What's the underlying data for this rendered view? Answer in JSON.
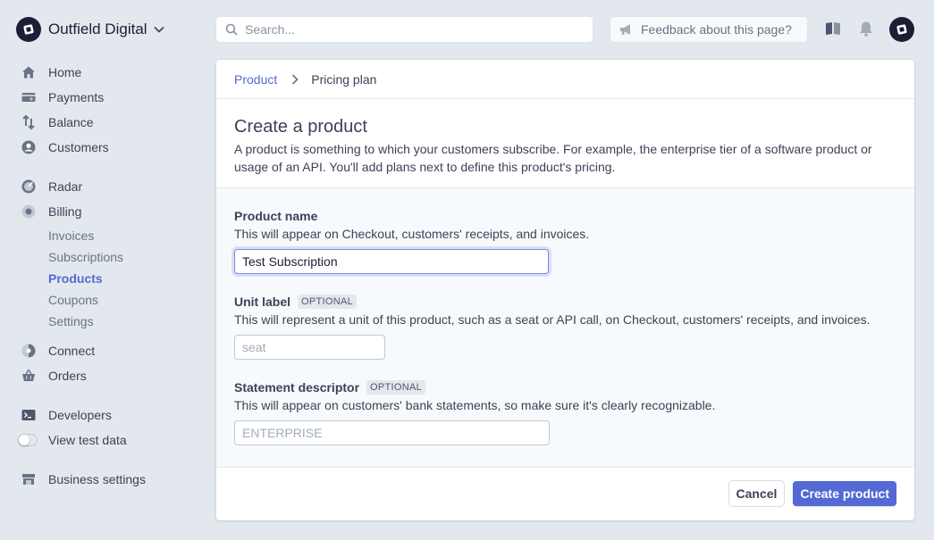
{
  "account": {
    "name": "Outfield Digital"
  },
  "search": {
    "placeholder": "Search..."
  },
  "feedback": {
    "label": "Feedback about this page?"
  },
  "nav": {
    "home": "Home",
    "payments": "Payments",
    "balance": "Balance",
    "customers": "Customers",
    "radar": "Radar",
    "billing": "Billing",
    "billing_sub": {
      "invoices": "Invoices",
      "subscriptions": "Subscriptions",
      "products": "Products",
      "coupons": "Coupons",
      "settings": "Settings"
    },
    "connect": "Connect",
    "orders": "Orders",
    "developers": "Developers",
    "test_data": "View test data",
    "business_settings": "Business settings"
  },
  "breadcrumb": {
    "parent": "Product",
    "current": "Pricing plan"
  },
  "intro": {
    "title": "Create a product",
    "description": "A product is something to which your customers subscribe. For example, the enterprise tier of a software product or usage of an API. You'll add plans next to define this product's pricing."
  },
  "form": {
    "product_name": {
      "label": "Product name",
      "help": "This will appear on Checkout, customers' receipts, and invoices.",
      "value": "Test Subscription"
    },
    "unit_label": {
      "label": "Unit label",
      "badge": "OPTIONAL",
      "help": "This will represent a unit of this product, such as a seat or API call, on Checkout, customers' receipts, and invoices.",
      "placeholder": "seat"
    },
    "statement_descriptor": {
      "label": "Statement descriptor",
      "badge": "OPTIONAL",
      "help": "This will appear on customers' bank statements, so make sure it's clearly recognizable.",
      "placeholder": "ENTERPRISE"
    }
  },
  "actions": {
    "cancel": "Cancel",
    "create": "Create product"
  },
  "colors": {
    "accent": "#5469d4",
    "sidebar_bg": "#e3e8ee",
    "form_bg": "#f7fafc"
  }
}
